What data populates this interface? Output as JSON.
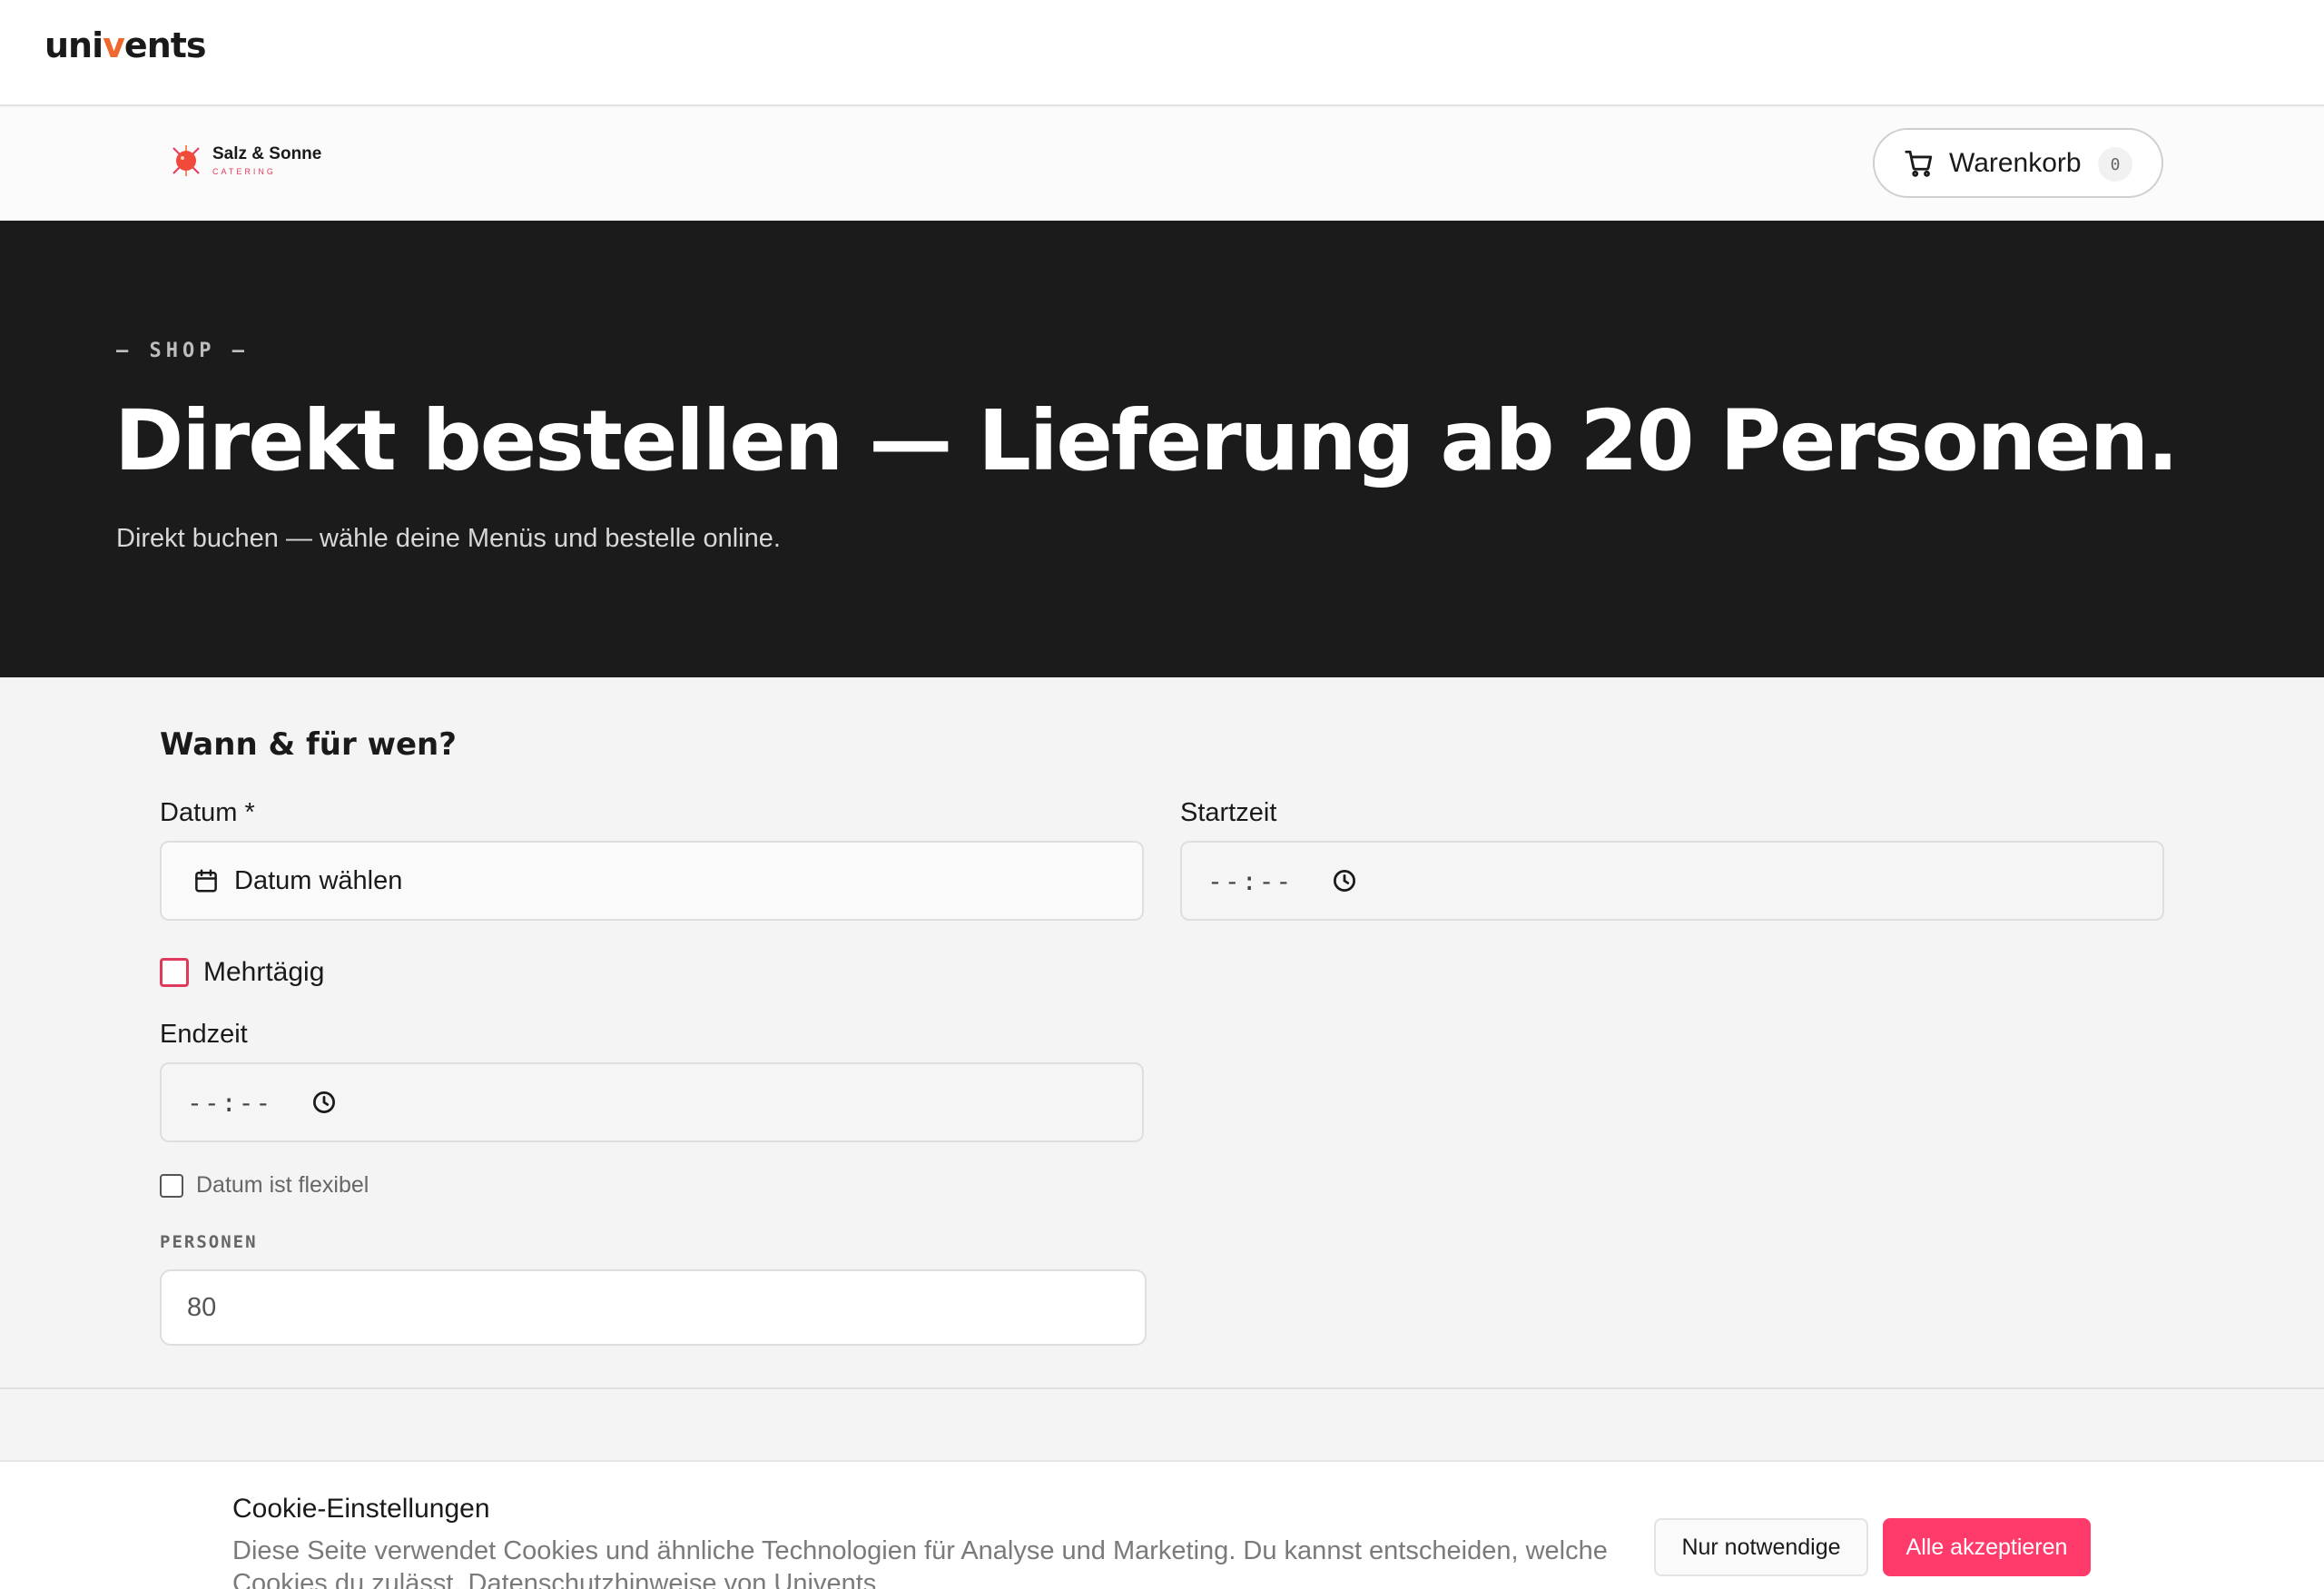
{
  "brand": {
    "prefix": "uni",
    "accent": "v",
    "suffix": "ents",
    "accent_color": "#f0672f"
  },
  "vendor": {
    "name": "Salz & Sonne",
    "tagline": "CATERING"
  },
  "cart": {
    "label": "Warenkorb",
    "count": "0"
  },
  "hero": {
    "eyebrow": "— SHOP —",
    "title": "Direkt bestellen — Lieferung ab 20 Personen.",
    "subtitle": "Direkt buchen — wähle deine Menüs und bestelle online."
  },
  "form": {
    "section_title": "Wann & für wen?",
    "date": {
      "label": "Datum *",
      "value": "Datum wählen",
      "icon": "calendar-icon"
    },
    "start_time": {
      "label": "Startzeit",
      "value": "--:--",
      "icon": "clock-icon"
    },
    "multi_day": {
      "label": "Mehrtägig",
      "checked": false
    },
    "end_time": {
      "label": "Endzeit",
      "value": "--:--",
      "icon": "clock-icon"
    },
    "date_flexible": {
      "label": "Datum ist flexibel",
      "checked": false
    },
    "persons": {
      "label": "PERSONEN",
      "value": "80"
    }
  },
  "cookie": {
    "title": "Cookie-Einstellungen",
    "text": "Diese Seite verwendet Cookies und ähnliche Technologien für Analyse und Marketing. Du kannst entscheiden, welche Cookies du zulässt. Datenschutzhinweise von Univents",
    "necessary_label": "Nur notwendige",
    "accept_label": "Alle akzeptieren"
  },
  "colors": {
    "primary": "#ff3b6b",
    "hero_bg": "#1c1b1b",
    "checkbox_accent": "#e03a5a"
  }
}
